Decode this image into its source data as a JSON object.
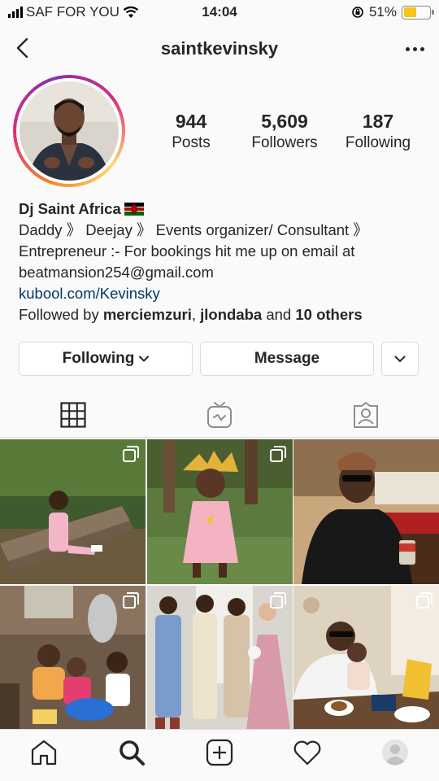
{
  "status_bar": {
    "carrier": "SAF FOR YOU",
    "time": "14:04",
    "battery": "51%",
    "battery_level": 0.51
  },
  "header": {
    "username": "saintkevinsky",
    "back_icon": "chevron-left-icon",
    "more_icon": "ellipsis-icon"
  },
  "profile": {
    "stats": [
      {
        "value": "944",
        "label": "Posts"
      },
      {
        "value": "5,609",
        "label": "Followers"
      },
      {
        "value": "187",
        "label": "Following"
      }
    ],
    "name": "Dj Saint Africa",
    "name_flag": "kenya-flag-emoji",
    "bio_lines": [
      "Daddy 》 Deejay 》 Events organizer/ Consultant 》",
      "Entrepreneur :- For bookings hit me up on email at",
      "beatmansion254@gmail.com"
    ],
    "link": "kubool.com/Kevinsky",
    "followed_by": {
      "prefix": "Followed by ",
      "user1": "merciemzuri",
      "sep": ", ",
      "user2": "jlondaba",
      "and": " and ",
      "others": "10 others"
    }
  },
  "actions": {
    "following_label": "Following",
    "message_label": "Message"
  },
  "tabs": [
    {
      "icon": "grid-icon",
      "active": true
    },
    {
      "icon": "igtv-icon",
      "active": false
    },
    {
      "icon": "tagged-icon",
      "active": false
    }
  ],
  "bottom_nav": [
    {
      "icon": "home-icon"
    },
    {
      "icon": "search-icon",
      "active": true
    },
    {
      "icon": "new-post-icon"
    },
    {
      "icon": "heart-icon"
    },
    {
      "icon": "profile-avatar-icon"
    }
  ],
  "colors": {
    "link": "#00376b",
    "battery": "#f5c518",
    "border": "#dbdbdb"
  }
}
